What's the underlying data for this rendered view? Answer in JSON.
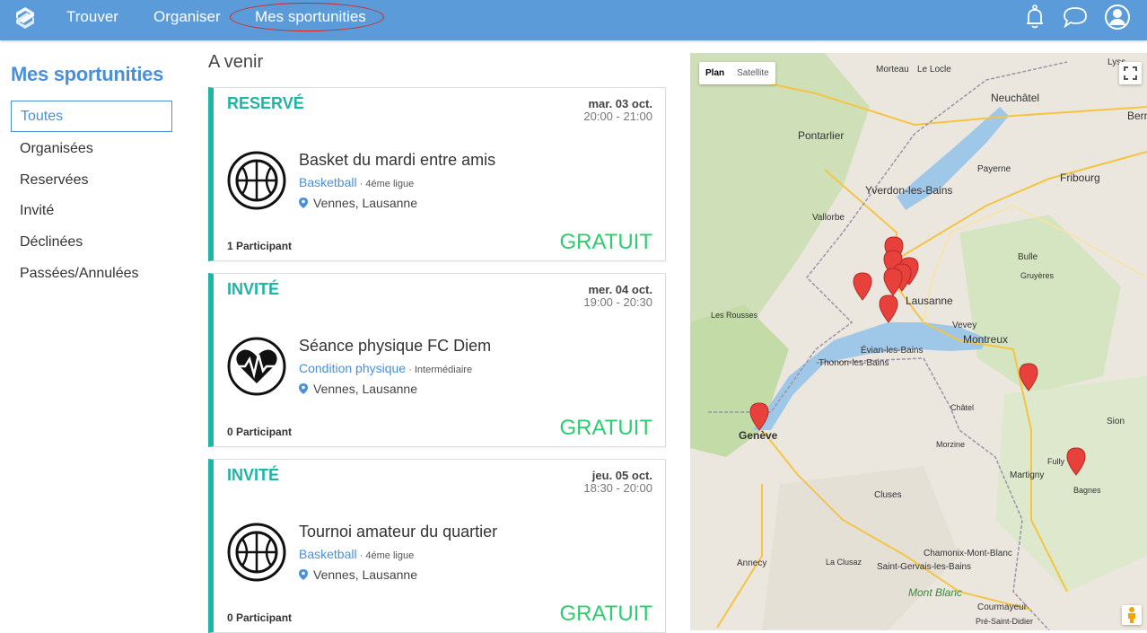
{
  "nav": {
    "links": [
      "Trouver",
      "Organiser",
      "Mes sportunities"
    ],
    "highlight_color": "#d9231f",
    "bar_color": "#5b9bd9"
  },
  "sidebar": {
    "title": "Mes sportunities",
    "items": [
      "Toutes",
      "Organisées",
      "Reservées",
      "Invité",
      "Déclinées",
      "Passées/Annulées"
    ],
    "active": "Toutes"
  },
  "main": {
    "section_title": "A venir",
    "accent": "#1eb5a4",
    "price_color": "#2ecc71",
    "cards": [
      {
        "status": "RESERVÉ",
        "date": "mar. 03 oct.",
        "time": "20:00 - 21:00",
        "icon": "basketball-icon",
        "title": "Basket du mardi entre amis",
        "sport": "Basketball",
        "sep": " · ",
        "level": "4éme ligue",
        "location": "Vennes, Lausanne",
        "participants": "1 Participant",
        "price": "GRATUIT"
      },
      {
        "status": "INVITÉ",
        "date": "mer. 04 oct.",
        "time": "19:00 - 20:30",
        "icon": "heartbeat-icon",
        "title": "Séance physique FC Diem",
        "sport": "Condition physique",
        "sep": " · ",
        "level": "Intermédiaire",
        "location": "Vennes, Lausanne",
        "participants": "0 Participant",
        "price": "GRATUIT"
      },
      {
        "status": "INVITÉ",
        "date": "jeu. 05 oct.",
        "time": "18:30 - 20:00",
        "icon": "basketball-icon",
        "title": "Tournoi amateur du quartier",
        "sport": "Basketball",
        "sep": " · ",
        "level": "4éme ligue",
        "location": "Vennes, Lausanne",
        "participants": "0 Participant",
        "price": "GRATUIT"
      }
    ]
  },
  "map": {
    "toggle": [
      "Plan",
      "Satellite"
    ],
    "lake_color": "#9fc7e8",
    "marker_color": "#e8413c",
    "labels": [
      "Morteau",
      "Le Locle",
      "Lyss",
      "Neuchâtel",
      "Bern",
      "Pontarlier",
      "Payerne",
      "Fribourg",
      "Yverdon-les-Bains",
      "Vallorbe",
      "Lausanne",
      "Vevey",
      "Montreux",
      "Évian-les-Bains",
      "Thonon-les-Bains",
      "Genève",
      "Annecy",
      "Sion",
      "Martigny",
      "Bagnes",
      "Chamonix-Mont-Blanc",
      "Saint-Gervais-les-Bains",
      "Mont Blanc",
      "Courmayeur",
      "Bulle",
      "Gruyères",
      "Les Rousses",
      "Cluses",
      "Morzine",
      "Châtel",
      "La Clusaz",
      "Pré-Saint-Didier",
      "Fully"
    ]
  }
}
